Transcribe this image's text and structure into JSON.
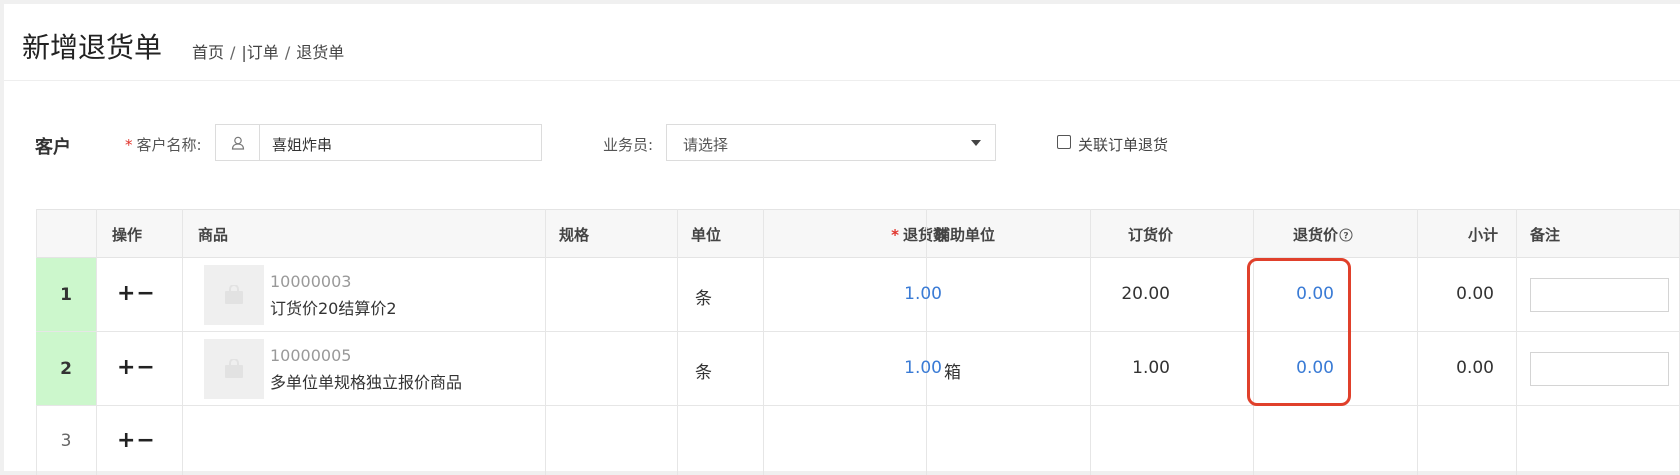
{
  "page": {
    "title": "新增退货单",
    "breadcrumb": [
      "首页",
      "|订单",
      "退货单"
    ]
  },
  "customer_section": {
    "label": "客户",
    "customer_name_label": "客户名称:",
    "customer_name_value": "喜姐炸串",
    "salesperson_label": "业务员:",
    "salesperson_value": "请选择",
    "link_order_return_label": "关联订单退货",
    "link_order_return_checked": false
  },
  "table": {
    "columns": [
      "",
      "操作",
      "商品",
      "规格",
      "单位",
      "退货数",
      "辅助单位",
      "订货价",
      "退货价",
      "小计",
      "备注"
    ],
    "ops_label": "+−",
    "rows": [
      {
        "index": "1",
        "code": "10000003",
        "name": "订货价20结算价2",
        "spec": "",
        "unit": "条",
        "qty": "1.00",
        "aux_unit": "",
        "order_price": "20.00",
        "return_price": "0.00",
        "subtotal": "0.00",
        "note": ""
      },
      {
        "index": "2",
        "code": "10000005",
        "name": "多单位单规格独立报价商品",
        "spec": "",
        "unit": "条",
        "qty": "1.00",
        "aux_unit": "箱",
        "order_price": "1.00",
        "return_price": "0.00",
        "subtotal": "0.00",
        "note": ""
      },
      {
        "index": "3"
      }
    ]
  },
  "colors": {
    "accent_blue": "#3a7bd5",
    "highlight_red": "#e0402b",
    "row_number_green": "#ccf7cc"
  }
}
